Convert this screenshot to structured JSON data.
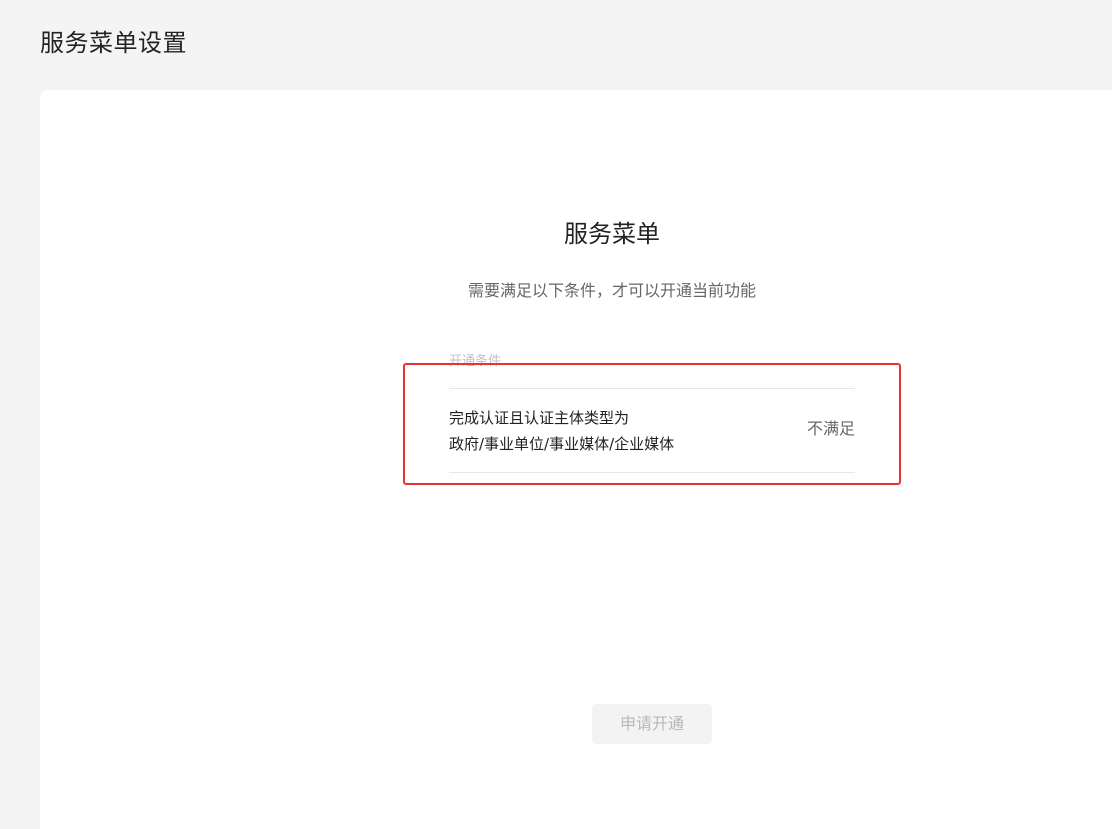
{
  "page": {
    "title": "服务菜单设置"
  },
  "main": {
    "title": "服务菜单",
    "subtitle": "需要满足以下条件，才可以开通当前功能",
    "conditions_label": "开通条件",
    "conditions": [
      {
        "text_line1": "完成认证且认证主体类型为",
        "text_line2": "政府/事业单位/事业媒体/企业媒体",
        "status": "不满足"
      }
    ],
    "apply_button_label": "申请开通"
  },
  "colors": {
    "background": "#f4f4f4",
    "card": "#ffffff",
    "highlight": "#e8322e",
    "button_disabled_bg": "#f3f3f3",
    "button_disabled_text": "#b8b8b8"
  }
}
